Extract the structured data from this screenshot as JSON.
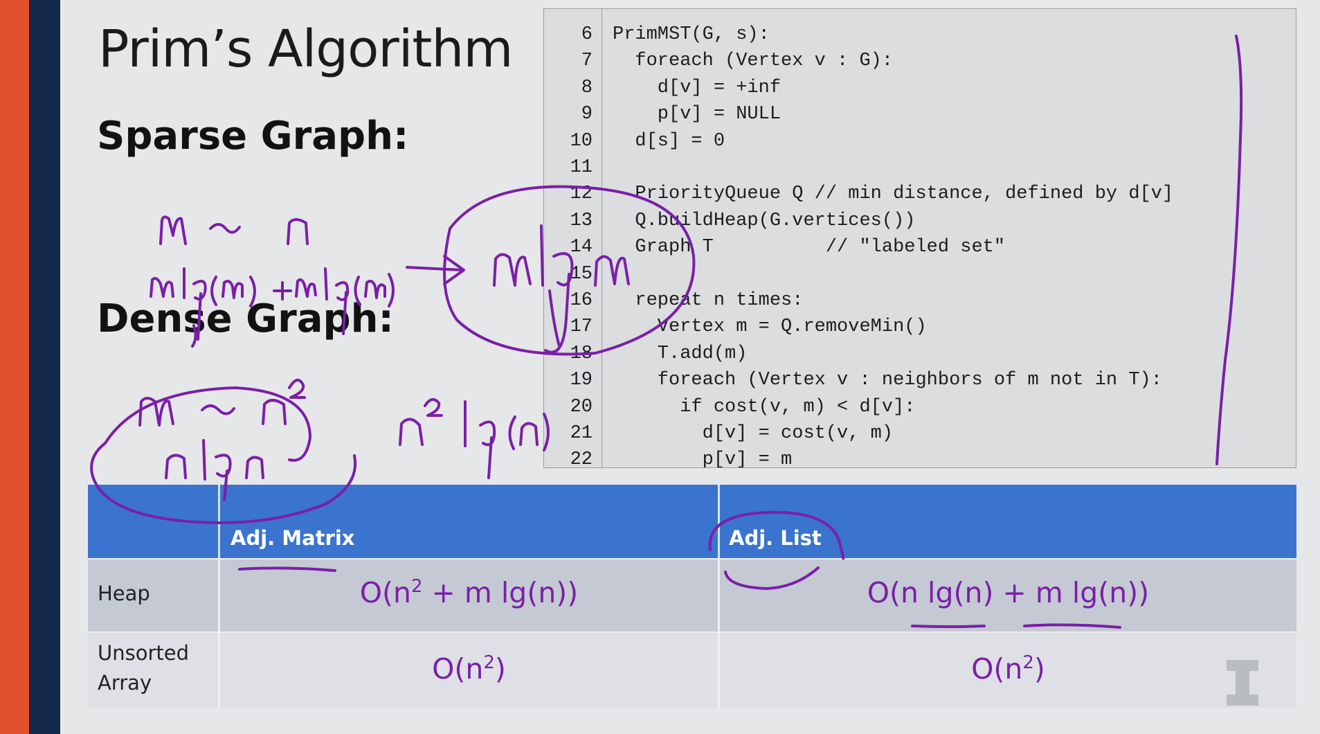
{
  "slide": {
    "title": "Prim’s Algorithm",
    "sparse_heading": "Sparse Graph:",
    "dense_heading": "Dense Graph:"
  },
  "code": {
    "lines": [
      {
        "num": "6",
        "text": "PrimMST(G, s):"
      },
      {
        "num": "7",
        "text": "  foreach (Vertex v : G):"
      },
      {
        "num": "8",
        "text": "    d[v] = +inf"
      },
      {
        "num": "9",
        "text": "    p[v] = NULL"
      },
      {
        "num": "10",
        "text": "  d[s] = 0"
      },
      {
        "num": "11",
        "text": ""
      },
      {
        "num": "12",
        "text": "  PriorityQueue Q // min distance, defined by d[v]"
      },
      {
        "num": "13",
        "text": "  Q.buildHeap(G.vertices())"
      },
      {
        "num": "14",
        "text": "  Graph T          // \"labeled set\""
      },
      {
        "num": "15",
        "text": ""
      },
      {
        "num": "16",
        "text": "  repeat n times:"
      },
      {
        "num": "17",
        "text": "    Vertex m = Q.removeMin()"
      },
      {
        "num": "18",
        "text": "    T.add(m)"
      },
      {
        "num": "19",
        "text": "    foreach (Vertex v : neighbors of m not in T):"
      },
      {
        "num": "20",
        "text": "      if cost(v, m) < d[v]:"
      },
      {
        "num": "21",
        "text": "        d[v] = cost(v, m)"
      },
      {
        "num": "22",
        "text": "        p[v] = m"
      }
    ]
  },
  "table": {
    "headers": [
      "",
      "Adj. Matrix",
      "Adj. List"
    ],
    "rows": [
      {
        "label_lines": [
          "Heap"
        ],
        "matrix": {
          "base": "O(n",
          "sup": "2",
          "rest": " + m lg(n))"
        },
        "list": {
          "base": "O(n lg(n) + m lg(n))",
          "sup": "",
          "rest": ""
        }
      },
      {
        "label_lines": [
          "Unsorted",
          "Array"
        ],
        "matrix": {
          "base": "O(n",
          "sup": "2",
          "rest": ")"
        },
        "list": {
          "base": "O(n",
          "sup": "2",
          "rest": ")"
        }
      }
    ]
  },
  "colors": {
    "accent_orange": "#e0502a",
    "navy": "#13294b",
    "table_header_blue": "#3a74cf",
    "ink_purple": "#7a1fa8"
  },
  "icons": {
    "logo": "block-i-logo"
  }
}
